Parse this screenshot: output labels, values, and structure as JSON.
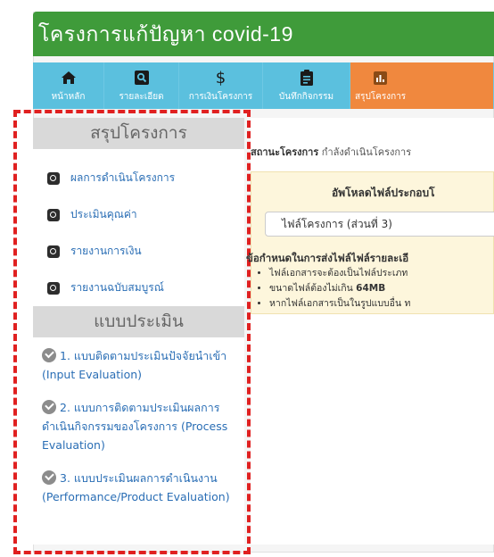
{
  "app": {
    "title": "โครงการแก้ปัญหา covid-19"
  },
  "nav": [
    {
      "label": "หน้าหลัก",
      "icon": "home-icon"
    },
    {
      "label": "รายละเอียด",
      "icon": "search-icon"
    },
    {
      "label": "การเงินโครงการ",
      "icon": "dollar-icon"
    },
    {
      "label": "บันทึกกิจกรรม",
      "icon": "clipboard-icon"
    },
    {
      "label": "สรุปโครงการ",
      "icon": "chart-icon",
      "active": true
    }
  ],
  "sidebar": {
    "summary_heading": "สรุปโครงการ",
    "links": [
      {
        "label": "ผลการดำเนินโครงการ",
        "icon": "search-icon"
      },
      {
        "label": "ประเมินคุณค่า",
        "icon": "search-icon"
      },
      {
        "label": "รายงานการเงิน",
        "icon": "search-icon"
      },
      {
        "label": "รายงานฉบับสมบูรณ์",
        "icon": "search-icon"
      }
    ],
    "eval_heading": "แบบประเมิน",
    "evaluations": [
      {
        "label": "1. แบบติดตามประเมินปัจจัยนำเข้า (Input Evaluation)"
      },
      {
        "label": "2. แบบการติดตามประเมินผลการดำเนินกิจกรรมของโครงการ (Process Evaluation)"
      },
      {
        "label": "3. แบบประเมินผลการดำเนินงาน (Performance/Product Evaluation)"
      }
    ]
  },
  "main": {
    "status_label": "สถานะโครงการ",
    "status_value": "กำลังดำเนินโครงการ",
    "upload_title": "อัพโหลดไฟล์ประกอบโ",
    "file_select_value": "ไฟล์โครงการ (ส่วนที่ 3)",
    "req_title": "ข้อกำหนดในการส่งไฟล์ไฟล์รายละเอี",
    "req_items": [
      {
        "text": "ไฟล์เอกสารจะต้องเป็นไฟล์ประเภท"
      },
      {
        "text": "ขนาดไฟล์ต้องไม่เกิน",
        "strong": "64MB"
      },
      {
        "text": "หากไฟล์เอกสารเป็นในรูปแบบอื่น ท"
      }
    ]
  },
  "colors": {
    "title_bar": "#3f9b3a",
    "nav_bg": "#5bc0de",
    "nav_active": "#f0883e",
    "link": "#2a6eb5",
    "highlight_frame": "#e02020"
  }
}
